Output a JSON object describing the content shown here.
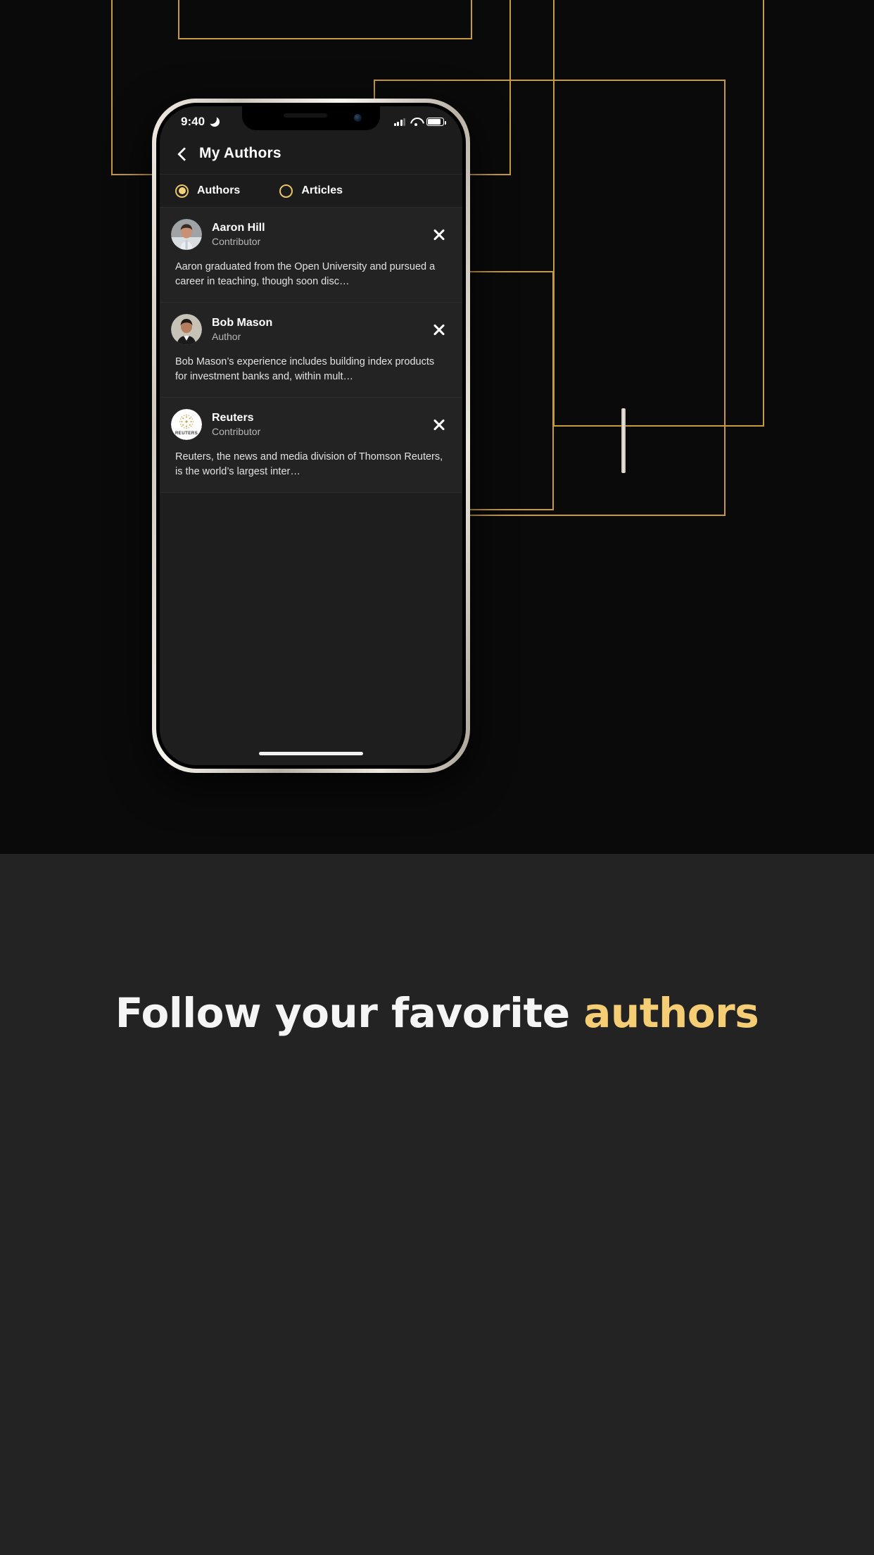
{
  "background": {
    "page_color": "#0a0a0a",
    "accent_line_color": "#c99a3a"
  },
  "caption": {
    "lead": "Follow your favorite ",
    "accent": "authors",
    "accent_color": "#f5cd74",
    "panel_color": "#232323"
  },
  "phone": {
    "status_bar": {
      "time": "9:40",
      "moon_icon": "moon-icon",
      "signal_icon": "cellular-signal-icon",
      "wifi_icon": "wifi-icon",
      "battery_icon": "battery-icon"
    },
    "header": {
      "back_icon": "back-chevron-icon",
      "title": "My Authors"
    },
    "tabs": [
      {
        "label": "Authors",
        "selected": true
      },
      {
        "label": "Articles",
        "selected": false
      }
    ],
    "tab_accent_color": "#f3d07a",
    "authors": [
      {
        "name": "Aaron Hill",
        "role": "Contributor",
        "description": "Aaron graduated from the Open University and pursued a career in teaching, though soon disc…",
        "avatar": "portrait-man-avatar",
        "remove_icon": "close-icon"
      },
      {
        "name": "Bob Mason",
        "role": "Author",
        "description": "Bob Mason’s experience includes building index products for investment banks and, within mult…",
        "avatar": "portrait-man-avatar",
        "remove_icon": "close-icon"
      },
      {
        "name": "Reuters",
        "role": "Contributor",
        "description": "Reuters, the news and media division of Thomson Reuters, is the world’s largest inter…",
        "avatar": "reuters-logo-avatar",
        "avatar_label": "REUTERS",
        "remove_icon": "close-icon"
      }
    ]
  }
}
